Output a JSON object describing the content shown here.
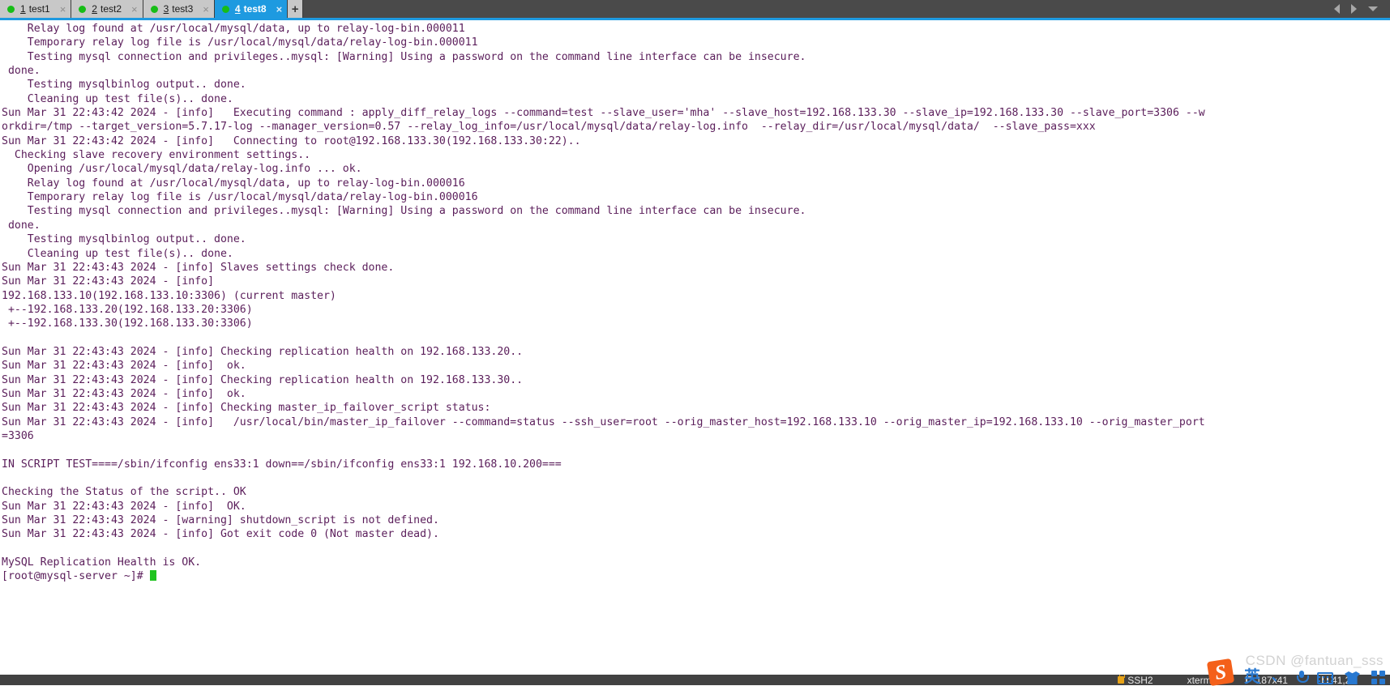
{
  "tabbar": {
    "tabs": [
      {
        "number": "1",
        "label": "test1",
        "active": false,
        "status": "connected",
        "close_label": "×"
      },
      {
        "number": "2",
        "label": "test2",
        "active": false,
        "status": "connected",
        "close_label": "×"
      },
      {
        "number": "3",
        "label": "test3",
        "active": false,
        "status": "connected",
        "close_label": "×"
      },
      {
        "number": "4",
        "label": "test8",
        "active": true,
        "status": "connected",
        "close_label": "×"
      }
    ],
    "add_label": "+",
    "accent_color": "#1e9ae0",
    "status_dot_color": "#17bd17"
  },
  "terminal": {
    "foreground_color": "#5a1d5a",
    "background_color": "#ffffff",
    "cursor_color": "#1fc31f",
    "lines": [
      "    Relay log found at /usr/local/mysql/data, up to relay-log-bin.000011",
      "    Temporary relay log file is /usr/local/mysql/data/relay-log-bin.000011",
      "    Testing mysql connection and privileges..mysql: [Warning] Using a password on the command line interface can be insecure.",
      " done.",
      "    Testing mysqlbinlog output.. done.",
      "    Cleaning up test file(s).. done.",
      "Sun Mar 31 22:43:42 2024 - [info]   Executing command : apply_diff_relay_logs --command=test --slave_user='mha' --slave_host=192.168.133.30 --slave_ip=192.168.133.30 --slave_port=3306 --w",
      "orkdir=/tmp --target_version=5.7.17-log --manager_version=0.57 --relay_log_info=/usr/local/mysql/data/relay-log.info  --relay_dir=/usr/local/mysql/data/  --slave_pass=xxx",
      "Sun Mar 31 22:43:42 2024 - [info]   Connecting to root@192.168.133.30(192.168.133.30:22)..",
      "  Checking slave recovery environment settings..",
      "    Opening /usr/local/mysql/data/relay-log.info ... ok.",
      "    Relay log found at /usr/local/mysql/data, up to relay-log-bin.000016",
      "    Temporary relay log file is /usr/local/mysql/data/relay-log-bin.000016",
      "    Testing mysql connection and privileges..mysql: [Warning] Using a password on the command line interface can be insecure.",
      " done.",
      "    Testing mysqlbinlog output.. done.",
      "    Cleaning up test file(s).. done.",
      "Sun Mar 31 22:43:43 2024 - [info] Slaves settings check done.",
      "Sun Mar 31 22:43:43 2024 - [info]",
      "192.168.133.10(192.168.133.10:3306) (current master)",
      " +--192.168.133.20(192.168.133.20:3306)",
      " +--192.168.133.30(192.168.133.30:3306)",
      "",
      "Sun Mar 31 22:43:43 2024 - [info] Checking replication health on 192.168.133.20..",
      "Sun Mar 31 22:43:43 2024 - [info]  ok.",
      "Sun Mar 31 22:43:43 2024 - [info] Checking replication health on 192.168.133.30..",
      "Sun Mar 31 22:43:43 2024 - [info]  ok.",
      "Sun Mar 31 22:43:43 2024 - [info] Checking master_ip_failover_script status:",
      "Sun Mar 31 22:43:43 2024 - [info]   /usr/local/bin/master_ip_failover --command=status --ssh_user=root --orig_master_host=192.168.133.10 --orig_master_ip=192.168.133.10 --orig_master_port",
      "=3306",
      "",
      "IN SCRIPT TEST====/sbin/ifconfig ens33:1 down==/sbin/ifconfig ens33:1 192.168.10.200===",
      "",
      "Checking the Status of the script.. OK",
      "Sun Mar 31 22:43:43 2024 - [info]  OK.",
      "Sun Mar 31 22:43:43 2024 - [warning] shutdown_script is not defined.",
      "Sun Mar 31 22:43:43 2024 - [info] Got exit code 0 (Not master dead).",
      "",
      "MySQL Replication Health is OK."
    ],
    "prompt": "[root@mysql-server ~]# "
  },
  "statusbar": {
    "protocol": "SSH2",
    "term_type": "xterm",
    "dimensions": "187x41",
    "cursor_pos": "41,24"
  },
  "ime": {
    "name": "sogou-ime",
    "logo_text": "S",
    "mode_label": "英",
    "punct_label": "、",
    "items": [
      "language-mode",
      "punctuation-mode",
      "voice-input",
      "soft-keyboard",
      "skin",
      "toolbox"
    ]
  },
  "watermark": {
    "text": "CSDN @fantuan_sss"
  }
}
